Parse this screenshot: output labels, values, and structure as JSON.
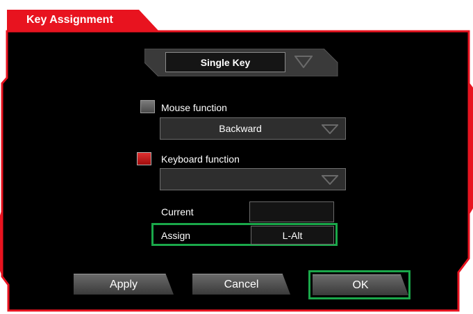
{
  "window": {
    "title": "Key Assignment"
  },
  "mode": {
    "selected": "Single Key"
  },
  "mouse_function": {
    "label": "Mouse function",
    "checked": false,
    "value": "Backward"
  },
  "keyboard_function": {
    "label": "Keyboard function",
    "checked": true,
    "value": ""
  },
  "current": {
    "label": "Current",
    "value": ""
  },
  "assign": {
    "label": "Assign",
    "value": "L-Alt"
  },
  "buttons": {
    "apply": "Apply",
    "cancel": "Cancel",
    "ok": "OK"
  },
  "colors": {
    "accent": "#e8131f",
    "panel": "#000000",
    "highlight": "#1aa84a"
  }
}
